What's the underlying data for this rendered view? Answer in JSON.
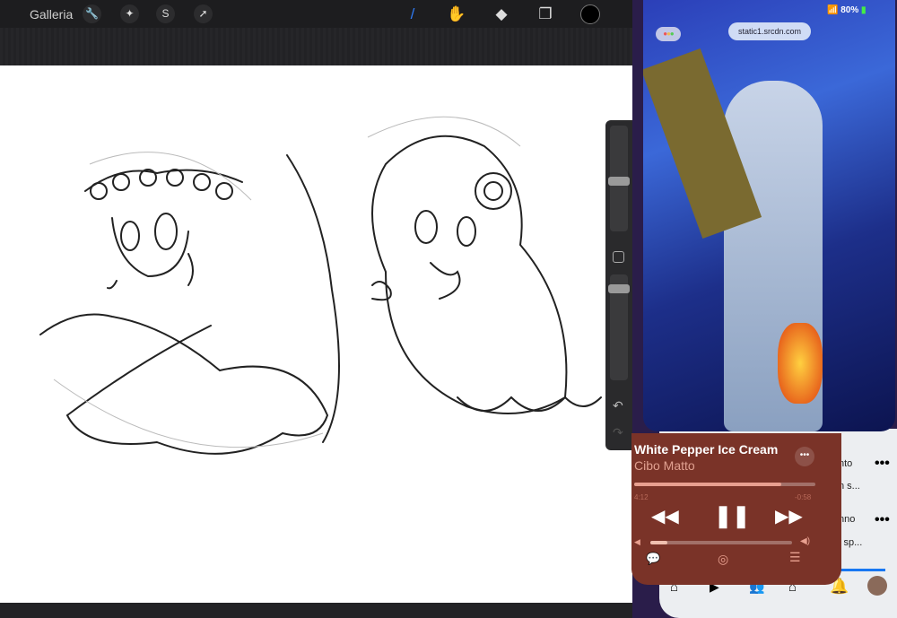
{
  "toolbar": {
    "gallery": "Galleria",
    "tools": [
      "wrench-icon",
      "magic-wand-icon",
      "selection-icon",
      "transform-arrow-icon"
    ],
    "right_tools": [
      "brush-icon",
      "smudge-icon",
      "eraser-icon",
      "layers-icon",
      "color-icon"
    ],
    "accent": "#2f7bf5",
    "current_color": "#000000"
  },
  "browser": {
    "url": "static1.srcdn.com"
  },
  "status": {
    "battery": "80%"
  },
  "music": {
    "title": "White Pepper Ice Cream",
    "artist": "Cibo Matto",
    "elapsed": "4:12",
    "remaining": "-0:58",
    "progress": 0.81,
    "volume": 0.12,
    "bg": "#7a3328"
  },
  "feed": {
    "snippets": [
      "nto",
      "n s...",
      "nno",
      ":",
      "i sp..."
    ]
  }
}
